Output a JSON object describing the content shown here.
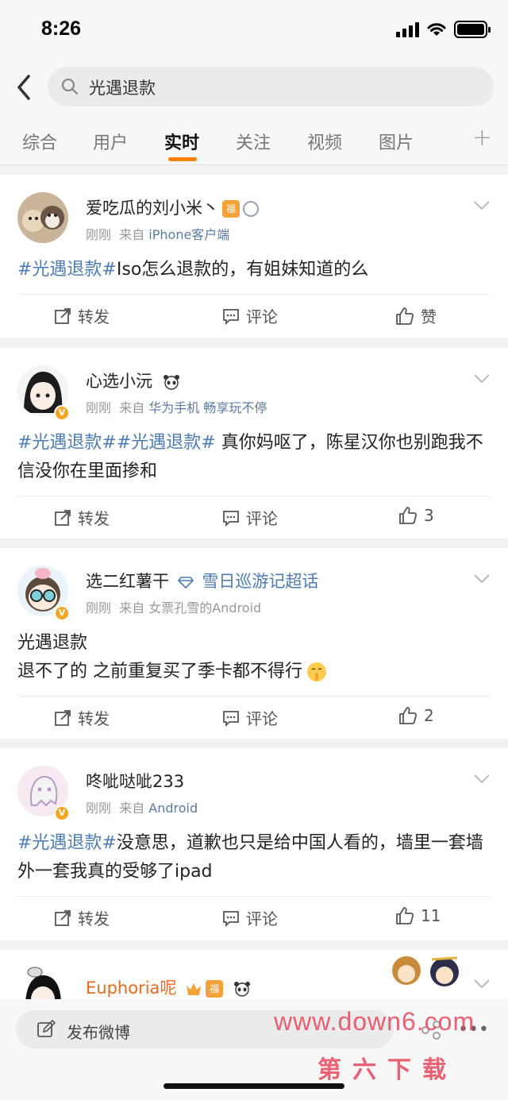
{
  "status_bar": {
    "time": "8:26"
  },
  "search": {
    "query": "光遇退款"
  },
  "tabs": [
    "综合",
    "用户",
    "实时",
    "关注",
    "视频",
    "图片"
  ],
  "active_tab": "实时",
  "colors": {
    "accent": "#ff8200",
    "link": "#4e7cb0"
  },
  "posts": [
    {
      "user": "爱吃瓜的刘小米丶",
      "badge": "福",
      "time": "刚刚",
      "from_prefix": "来自",
      "source": "iPhone客户端",
      "hashtag": "#光遇退款#",
      "text": "Iso怎么退款的，有姐妹知道的么",
      "actions": {
        "repost": "转发",
        "comment": "评论",
        "like": "赞"
      }
    },
    {
      "user": "心选小沅",
      "verified": "V",
      "time": "刚刚",
      "from_prefix": "来自",
      "source": "华为手机 畅享玩不停",
      "hashtag": "#光遇退款##光遇退款#",
      "text": " 真你妈呕了，陈星汉你也别跑我不信没你在里面掺和",
      "actions": {
        "repost": "转发",
        "comment": "评论",
        "like": "3"
      }
    },
    {
      "user": "选二红薯干",
      "super_topic": "雪日巡游记超话",
      "verified": "V",
      "time": "刚刚",
      "from_prefix": "来自",
      "source": "女票孔雪的Android",
      "line1": "光遇退款",
      "line2": "退不了的 之前重复买了季卡都不得行",
      "actions": {
        "repost": "转发",
        "comment": "评论",
        "like": "2"
      }
    },
    {
      "user": "咚呲哒呲233",
      "verified": "V",
      "time": "刚刚",
      "from_prefix": "来自",
      "source": "Android",
      "hashtag": "#光遇退款#",
      "text": "没意思，道歉也只是给中国人看的，墙里一套墙外一套我真的受够了ipad",
      "actions": {
        "repost": "转发",
        "comment": "评论",
        "like": "11"
      }
    },
    {
      "user": "Euphoria呢",
      "badge": "福"
    }
  ],
  "bottom": {
    "compose": "发布微博",
    "watermark_url": "www.down6.com",
    "watermark_cn": "第六下载"
  }
}
